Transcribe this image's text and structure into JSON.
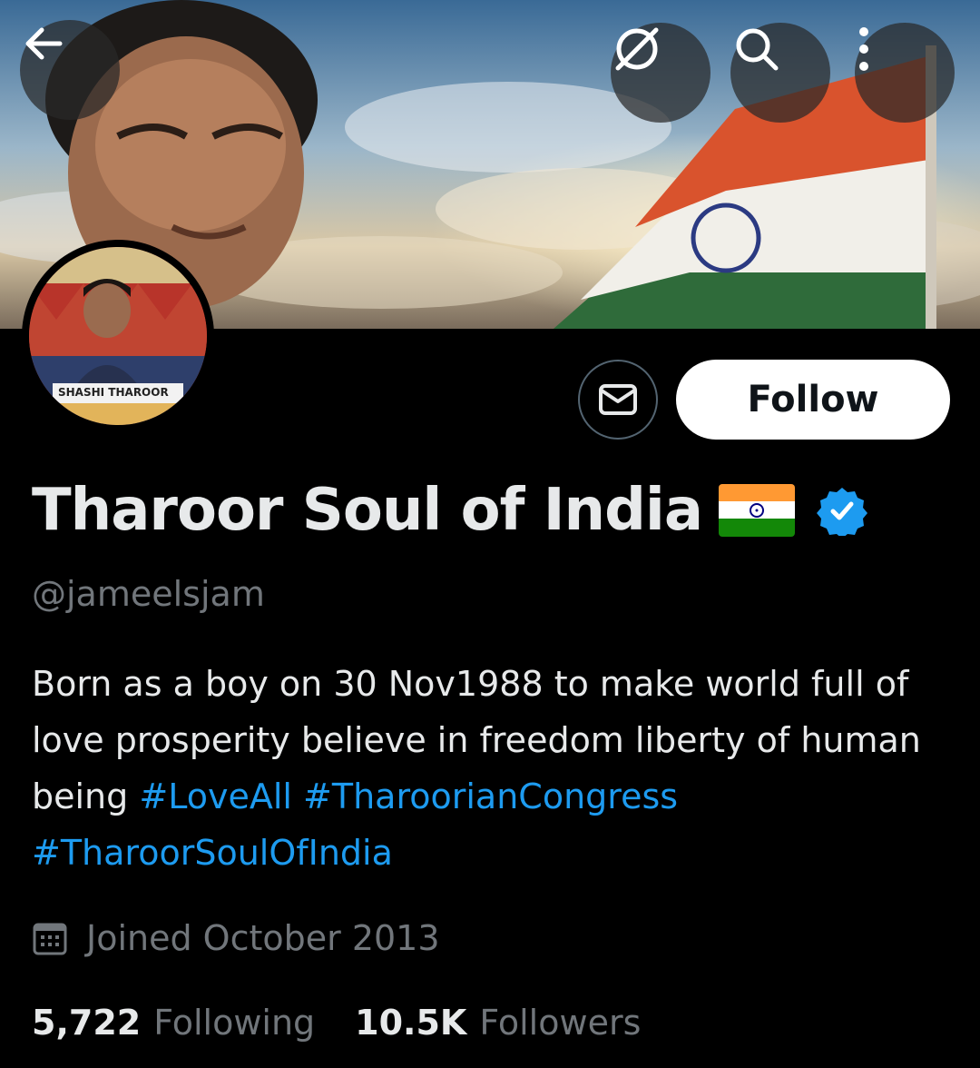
{
  "header": {
    "back_icon": "arrow-left-icon",
    "grok_icon": "grok-icon",
    "search_icon": "search-icon",
    "more_icon": "more-vertical-icon"
  },
  "avatar": {
    "caption": "SHASHI THAROOR"
  },
  "actions": {
    "message_icon": "envelope-icon",
    "follow_label": "Follow"
  },
  "profile": {
    "name": "Tharoor Soul of India",
    "flag": "🇮🇳",
    "verified": true,
    "handle": "@jameelsjam",
    "bio_text": "Born as a boy on 30 Nov1988 to make world full of love prosperity believe in freedom liberty of human being",
    "bio_tags": [
      "#LoveAll",
      "#TharoorianCongress",
      "#TharoorSoulOfIndia"
    ],
    "joined": "Joined October 2013"
  },
  "stats": {
    "following_count": "5,722",
    "following_label": "Following",
    "followers_count": "10.5K",
    "followers_label": "Followers"
  },
  "colors": {
    "background": "#000000",
    "text_primary": "#e7e9ea",
    "text_secondary": "#71767b",
    "link": "#1d9bf0",
    "verified": "#1d9bf0",
    "follow_button": "#ffffff"
  }
}
